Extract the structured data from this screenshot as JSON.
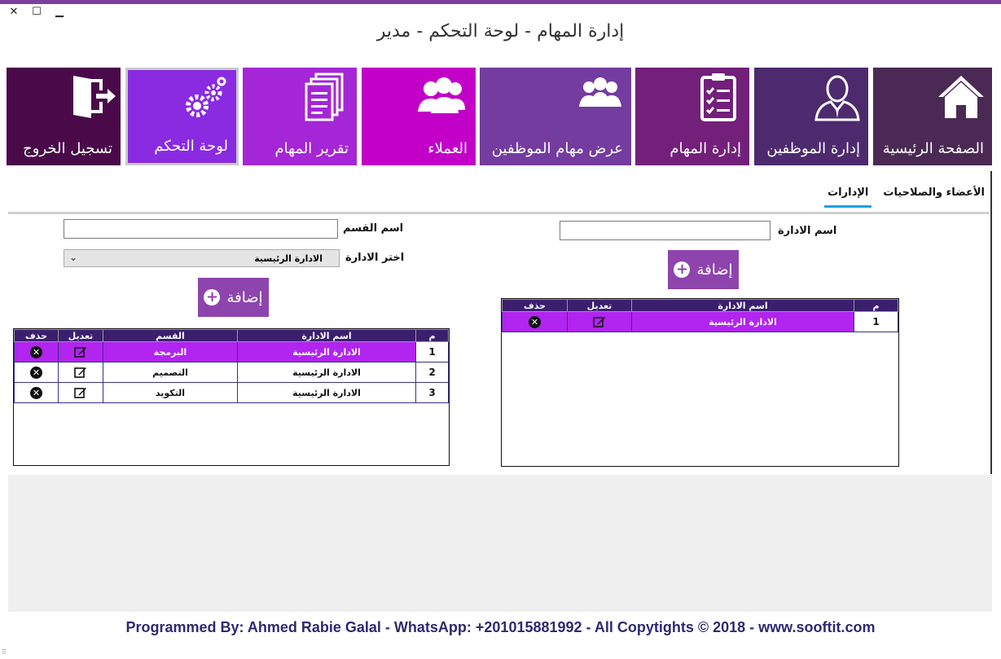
{
  "window": {
    "title": "إدارة المهام - لوحة التحكم - مدير",
    "controls": {
      "close": "✕",
      "maximize": "☐",
      "minimize": "▁"
    }
  },
  "tiles": [
    {
      "id": "home",
      "label": "الصفحة الرئيسية",
      "icon": "home-icon",
      "color": "#4a2a55"
    },
    {
      "id": "employees",
      "label": "إدارة الموظفين",
      "icon": "employee-icon",
      "color": "#4d2a6e"
    },
    {
      "id": "tasks",
      "label": "إدارة المهام",
      "icon": "clipboard-checklist-icon",
      "color": "#73207a"
    },
    {
      "id": "employee-tasks",
      "label": "عرض مهام الموظفين",
      "icon": "group-icon",
      "color": "#733c9e"
    },
    {
      "id": "clients",
      "label": "العملاء",
      "icon": "users-icon",
      "color": "#c200c8"
    },
    {
      "id": "task-report",
      "label": "تقرير المهام",
      "icon": "documents-icon",
      "color": "#a526d6"
    },
    {
      "id": "control-panel",
      "label": "لوحة التحكم",
      "icon": "gears-icon",
      "color": "#8a2be2",
      "selected": true
    },
    {
      "id": "logout",
      "label": "تسجيل الخروج",
      "icon": "exit-door-icon",
      "color": "#4a0a4a"
    }
  ],
  "tabs": [
    {
      "label": "الإدارات",
      "active": true
    },
    {
      "label": "الأعضاء والصلاحيات",
      "active": false
    }
  ],
  "departments": {
    "name_label": "اسم الادارة",
    "name_value": "",
    "add_label": "إضافة",
    "columns": {
      "num": "م",
      "name": "اسم الادارة",
      "edit": "تعديل",
      "delete": "حذف"
    },
    "rows": [
      {
        "num": "1",
        "name": "الادارة الرئيسية",
        "selected": true
      }
    ]
  },
  "sections": {
    "name_label": "اسم القسم",
    "name_value": "",
    "select_label": "اختر الادارة",
    "select_value": "الادارة الرئيسية",
    "add_label": "إضافة",
    "columns": {
      "num": "م",
      "dept": "اسم الادارة",
      "section": "القسم",
      "edit": "تعديل",
      "delete": "حذف"
    },
    "rows": [
      {
        "num": "1",
        "dept": "الادارة الرئيسية",
        "section": "البرمجة",
        "selected": true
      },
      {
        "num": "2",
        "dept": "الادارة الرئيسية",
        "section": "التصميم",
        "selected": false
      },
      {
        "num": "3",
        "dept": "الادارة الرئيسية",
        "section": "التكويد",
        "selected": false
      }
    ]
  },
  "footer": {
    "text": "Programmed By: Ahmed Rabie Galal - WhatsApp: +201015881992 - All Copytights © 2018 - www.sooftit.com"
  },
  "colors": {
    "accent_tab": "#1ba1e2",
    "header_row": "#3b1f6e",
    "selected_row": "#b224ef",
    "add_button": "#8e44ad",
    "footer_text": "#2d2a6e"
  }
}
